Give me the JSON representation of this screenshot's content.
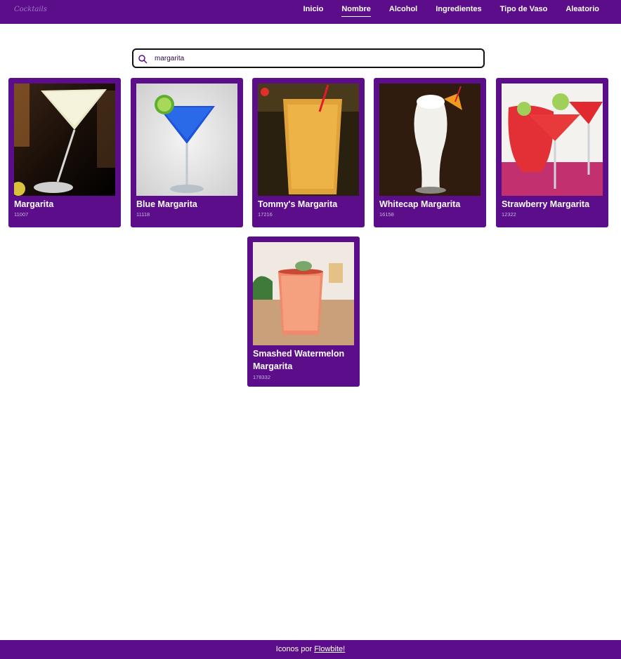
{
  "nav": {
    "logo": "Cocktails",
    "items": [
      {
        "label": "Inicio",
        "active": false
      },
      {
        "label": "Nombre",
        "active": true
      },
      {
        "label": "Alcohol",
        "active": false
      },
      {
        "label": "Ingredientes",
        "active": false
      },
      {
        "label": "Tipo de Vaso",
        "active": false
      },
      {
        "label": "Aleatorio",
        "active": false
      }
    ]
  },
  "search": {
    "value": "margarita",
    "icon": "search-icon"
  },
  "results": [
    {
      "name": "Margarita",
      "id": "11007",
      "image": "margarita-photo"
    },
    {
      "name": "Blue Margarita",
      "id": "11118",
      "image": "blue-margarita-photo"
    },
    {
      "name": "Tommy's Margarita",
      "id": "17216",
      "image": "tommys-margarita-photo"
    },
    {
      "name": "Whitecap Margarita",
      "id": "16158",
      "image": "whitecap-margarita-photo"
    },
    {
      "name": "Strawberry Margarita",
      "id": "12322",
      "image": "strawberry-margarita-photo"
    },
    {
      "name": "Smashed Watermelon Margarita",
      "id": "178332",
      "image": "smashed-watermelon-margarita-photo"
    }
  ],
  "footer": {
    "prefix": "Iconos por",
    "link": "Flowbite!"
  },
  "colors": {
    "brand": "#5b0d8a",
    "background": "#ffffff",
    "footer_text": "#ffffff"
  }
}
